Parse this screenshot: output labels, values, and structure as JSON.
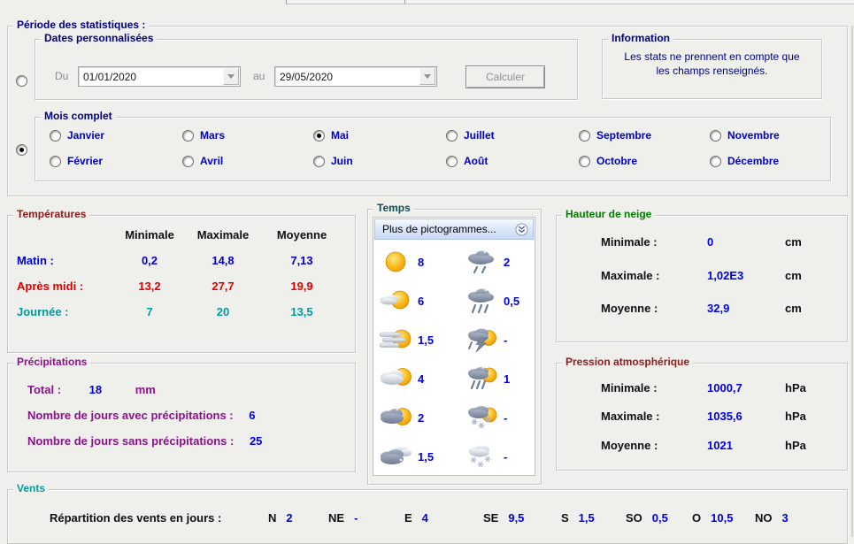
{
  "periode": {
    "title": "Période des statistiques :",
    "custom": {
      "title": "Dates personnalisées",
      "radio_selected": false,
      "du_label": "Du",
      "du_value": "01/01/2020",
      "au_label": "au",
      "au_value": "29/05/2020",
      "calculer_label": "Calculer"
    },
    "info": {
      "title": "Information",
      "line1": "Les stats ne prennent en compte que",
      "line2": "les champs renseignés."
    },
    "mois": {
      "title": "Mois complet",
      "radio_selected": true,
      "months": [
        {
          "label": "Janvier",
          "selected": false
        },
        {
          "label": "Février",
          "selected": false
        },
        {
          "label": "Mars",
          "selected": false
        },
        {
          "label": "Avril",
          "selected": false
        },
        {
          "label": "Mai",
          "selected": true
        },
        {
          "label": "Juin",
          "selected": false
        },
        {
          "label": "Juillet",
          "selected": false
        },
        {
          "label": "Août",
          "selected": false
        },
        {
          "label": "Septembre",
          "selected": false
        },
        {
          "label": "Octobre",
          "selected": false
        },
        {
          "label": "Novembre",
          "selected": false
        },
        {
          "label": "Décembre",
          "selected": false
        }
      ]
    }
  },
  "temperatures": {
    "title": "Températures",
    "headers": [
      "Minimale",
      "Maximale",
      "Moyenne"
    ],
    "rows": [
      {
        "label": "Matin :",
        "min": "0,2",
        "max": "14,8",
        "avg": "7,13"
      },
      {
        "label": "Après midi :",
        "min": "13,2",
        "max": "27,7",
        "avg": "19,9"
      },
      {
        "label": "Journée :",
        "min": "7",
        "max": "20",
        "avg": "13,5"
      }
    ]
  },
  "temps": {
    "title": "Temps",
    "more_button": "Plus de pictogrammes...",
    "pictos": [
      {
        "icon": "sun",
        "value": "8"
      },
      {
        "icon": "light-rain",
        "value": "2"
      },
      {
        "icon": "sun-with-small-cloud",
        "value": "6"
      },
      {
        "icon": "heavy-rain",
        "value": "0,5"
      },
      {
        "icon": "sun-with-wind",
        "value": "1,5"
      },
      {
        "icon": "thunderstorm-sun",
        "value": "-"
      },
      {
        "icon": "cloud-with-sun",
        "value": "4"
      },
      {
        "icon": "rain-with-sun",
        "value": "1"
      },
      {
        "icon": "dark-cloud-with-sun",
        "value": "2"
      },
      {
        "icon": "snow-with-sun",
        "value": "-"
      },
      {
        "icon": "dark-clouds",
        "value": "1,5"
      },
      {
        "icon": "snow",
        "value": "-"
      }
    ]
  },
  "neige": {
    "title": "Hauteur de neige",
    "rows": [
      {
        "label": "Minimale :",
        "value": "0",
        "unit": "cm"
      },
      {
        "label": "Maximale :",
        "value": "1,02E3",
        "unit": "cm"
      },
      {
        "label": "Moyenne :",
        "value": "32,9",
        "unit": "cm"
      }
    ]
  },
  "precipitations": {
    "title": "Précipitations",
    "total_label": "Total :",
    "total_value": "18",
    "total_unit": "mm",
    "avec_label": "Nombre de jours avec précipitations :",
    "avec_value": "6",
    "sans_label": "Nombre de jours sans précipitations :",
    "sans_value": "25"
  },
  "pression": {
    "title": "Pression atmosphérique",
    "rows": [
      {
        "label": "Minimale :",
        "value": "1000,7",
        "unit": "hPa"
      },
      {
        "label": "Maximale :",
        "value": "1035,6",
        "unit": "hPa"
      },
      {
        "label": "Moyenne :",
        "value": "1021",
        "unit": "hPa"
      }
    ]
  },
  "vents": {
    "title": "Vents",
    "label": "Répartition des vents en jours :",
    "directions": [
      {
        "dir": "N",
        "value": "2"
      },
      {
        "dir": "NE",
        "value": "-"
      },
      {
        "dir": "E",
        "value": "4"
      },
      {
        "dir": "SE",
        "value": "9,5"
      },
      {
        "dir": "S",
        "value": "1,5"
      },
      {
        "dir": "SO",
        "value": "0,5"
      },
      {
        "dir": "O",
        "value": "10,5"
      },
      {
        "dir": "NO",
        "value": "3"
      }
    ]
  },
  "colors": {
    "navy": "#000080",
    "month_blue": "#0000c8",
    "value_blue": "#0000e8",
    "matin_blue": "#0000d2",
    "apres_red": "#e00000",
    "journee_teal": "#009b9b",
    "temp_title_red": "#8f1a1a",
    "neige_green": "#008000",
    "precip_purple": "#8c128c",
    "pression_red": "#8f1a1a",
    "vents_teal": "#0b9b9b",
    "temps_dark_teal": "#0d4f55",
    "background": "#efefec"
  }
}
